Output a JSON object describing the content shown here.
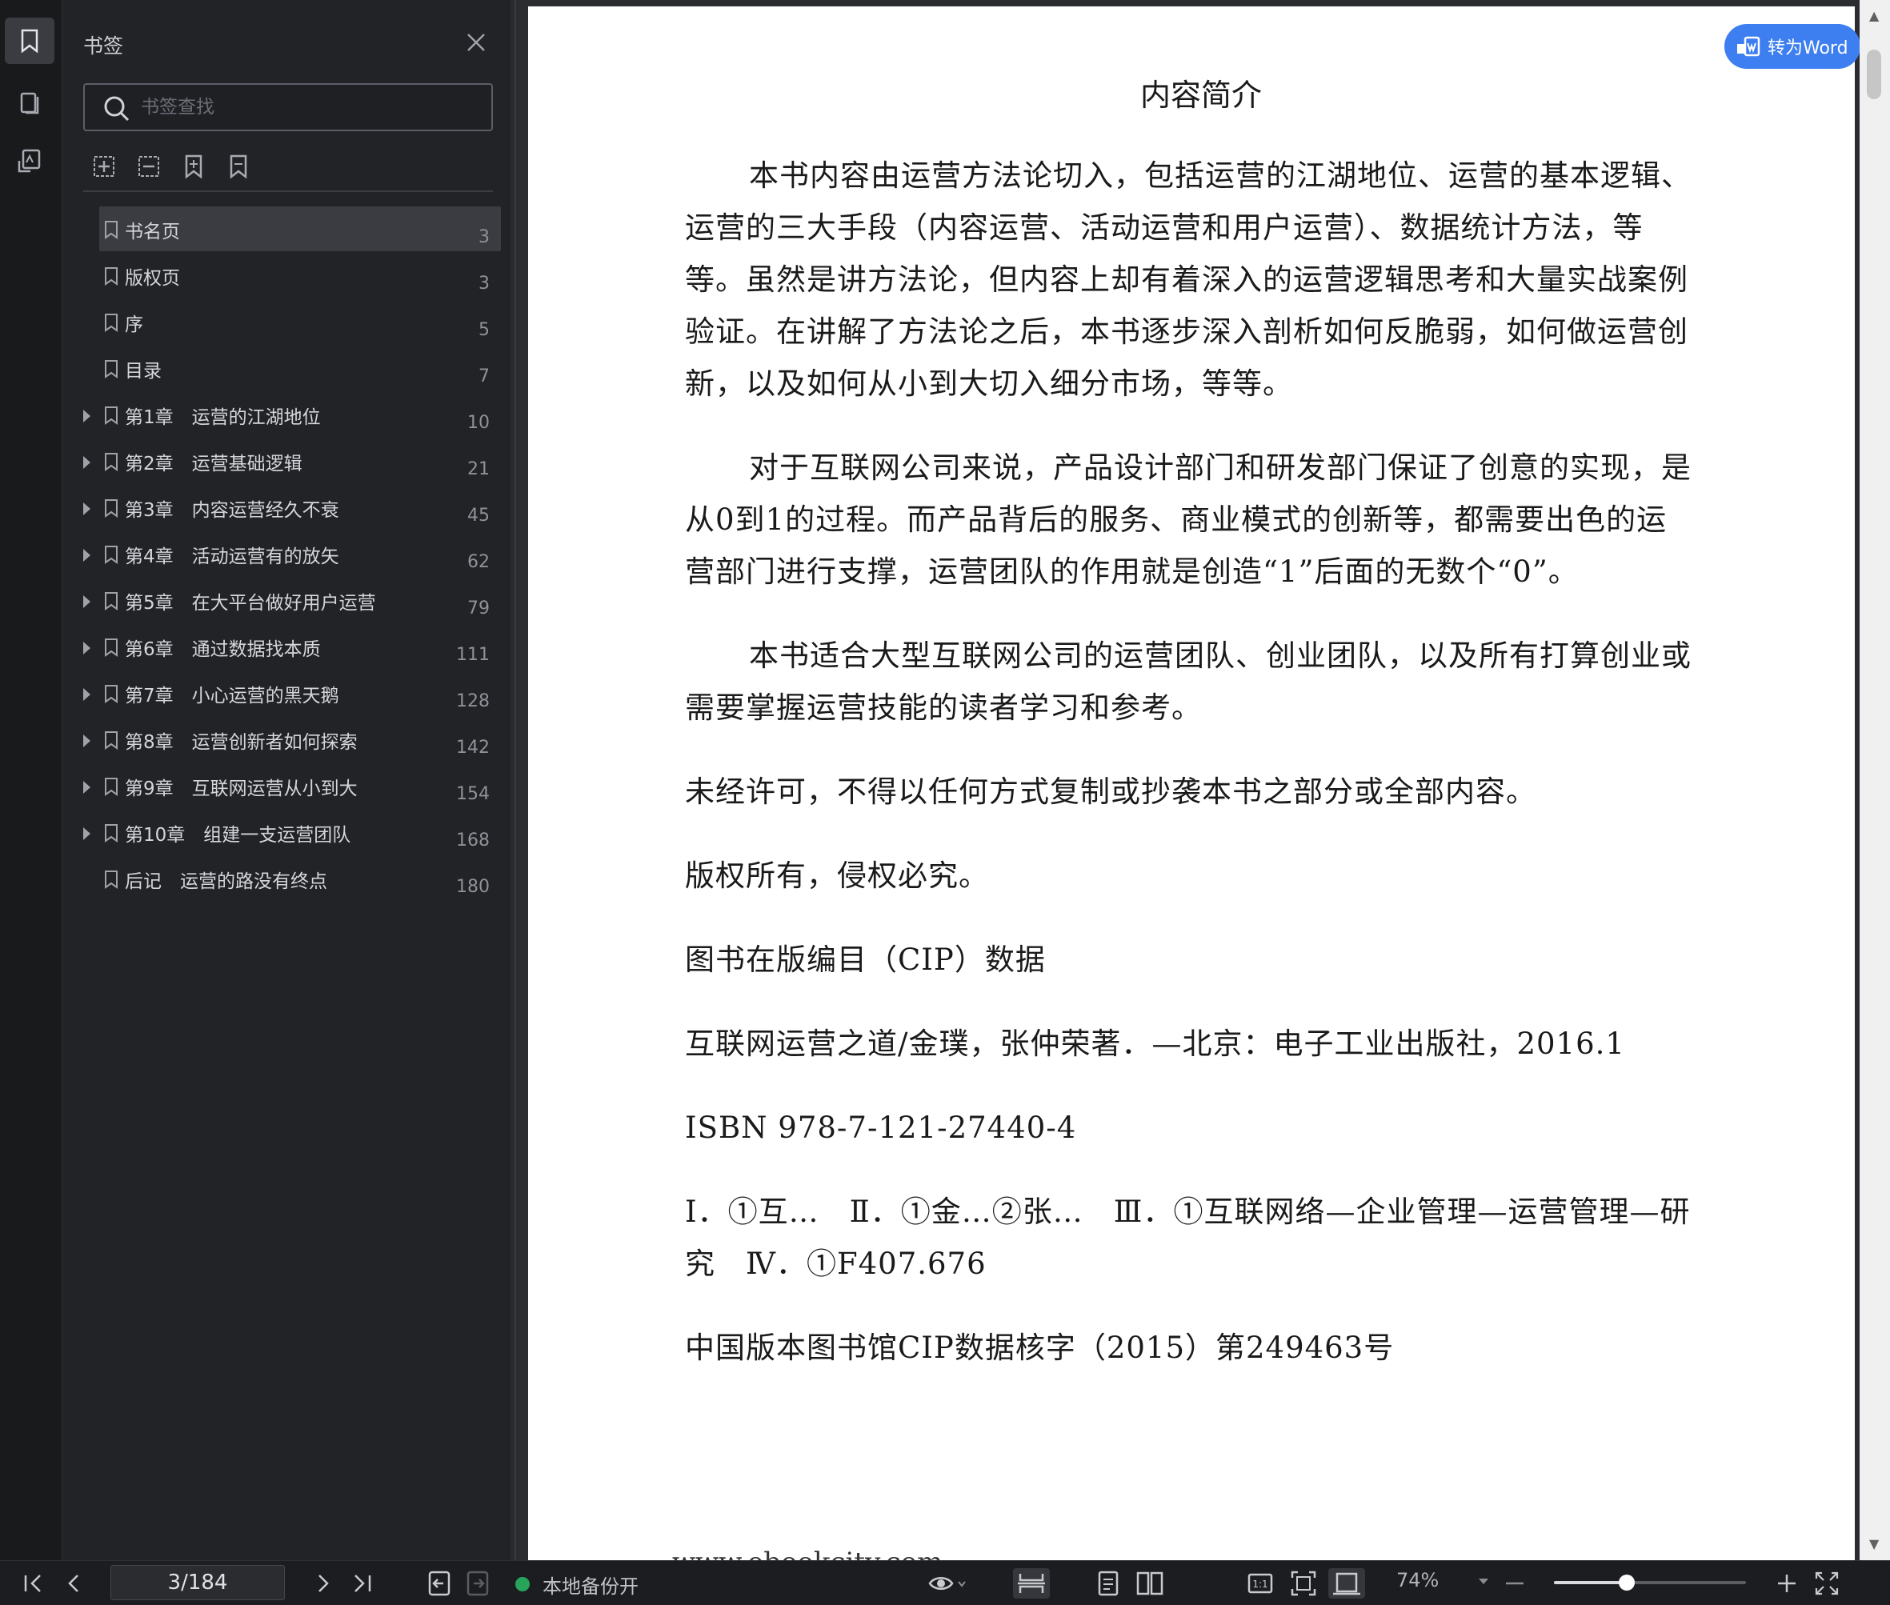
{
  "panel": {
    "title": "书签",
    "search_placeholder": "书签查找"
  },
  "bookmarks": [
    {
      "label": "书名页",
      "page": "3",
      "expandable": false,
      "active": true
    },
    {
      "label": "版权页",
      "page": "3",
      "expandable": false,
      "active": false
    },
    {
      "label": "序",
      "page": "5",
      "expandable": false,
      "active": false
    },
    {
      "label": "目录",
      "page": "7",
      "expandable": false,
      "active": false
    },
    {
      "label": "第1章　运营的江湖地位",
      "page": "10",
      "expandable": true,
      "active": false
    },
    {
      "label": "第2章　运营基础逻辑",
      "page": "21",
      "expandable": true,
      "active": false
    },
    {
      "label": "第3章　内容运营经久不衰",
      "page": "45",
      "expandable": true,
      "active": false
    },
    {
      "label": "第4章　活动运营有的放矢",
      "page": "62",
      "expandable": true,
      "active": false
    },
    {
      "label": "第5章　在大平台做好用户运营",
      "page": "79",
      "expandable": true,
      "active": false
    },
    {
      "label": "第6章　通过数据找本质",
      "page": "111",
      "expandable": true,
      "active": false
    },
    {
      "label": "第7章　小心运营的黑天鹅",
      "page": "128",
      "expandable": true,
      "active": false
    },
    {
      "label": "第8章　运营创新者如何探索",
      "page": "142",
      "expandable": true,
      "active": false
    },
    {
      "label": "第9章　互联网运营从小到大",
      "page": "154",
      "expandable": true,
      "active": false
    },
    {
      "label": "第10章　组建一支运营团队",
      "page": "168",
      "expandable": true,
      "active": false
    },
    {
      "label": "后记　运营的路没有终点",
      "page": "180",
      "expandable": false,
      "active": false
    }
  ],
  "document": {
    "to_word_label": "转为Word",
    "title": "内容简介",
    "paragraphs": [
      "本书内容由运营方法论切入，包括运营的江湖地位、运营的基本逻辑、运营的三大手段（内容运营、活动运营和用户运营）、数据统计方法，等等。虽然是讲方法论，但内容上却有着深入的运营逻辑思考和大量实战案例验证。在讲解了方法论之后，本书逐步深入剖析如何反脆弱，如何做运营创新，以及如何从小到大切入细分市场，等等。",
      "对于互联网公司来说，产品设计部门和研发部门保证了创意的实现，是从0到1的过程。而产品背后的服务、商业模式的创新等，都需要出色的运营部门进行支撑，运营团队的作用就是创造“1”后面的无数个“0”。",
      "本书适合大型互联网公司的运营团队、创业团队，以及所有打算创业或需要掌握运营技能的读者学习和参考。"
    ],
    "lines": [
      "未经许可，不得以任何方式复制或抄袭本书之部分或全部内容。",
      "版权所有，侵权必究。",
      "图书在版编目（CIP）数据",
      "互联网运营之道/金璞，张仲荣著．—北京：电子工业出版社，2016.1",
      "ISBN 978-7-121-27440-4",
      "Ⅰ．①互…　Ⅱ．①金…②张…　Ⅲ．①互联网络—企业管理—运营管理—研究　Ⅳ．①F407.676",
      "中国版本图书馆CIP数据核字（2015）第249463号"
    ],
    "footer_partial": "www.ebookcity.com"
  },
  "statusbar": {
    "page_indicator": "3/184",
    "backup_label": "本地备份开",
    "zoom_label": "74%",
    "zoom_fraction": 0.38
  },
  "colors": {
    "accent": "#3d7ef0",
    "backup_on": "#27a35a"
  }
}
